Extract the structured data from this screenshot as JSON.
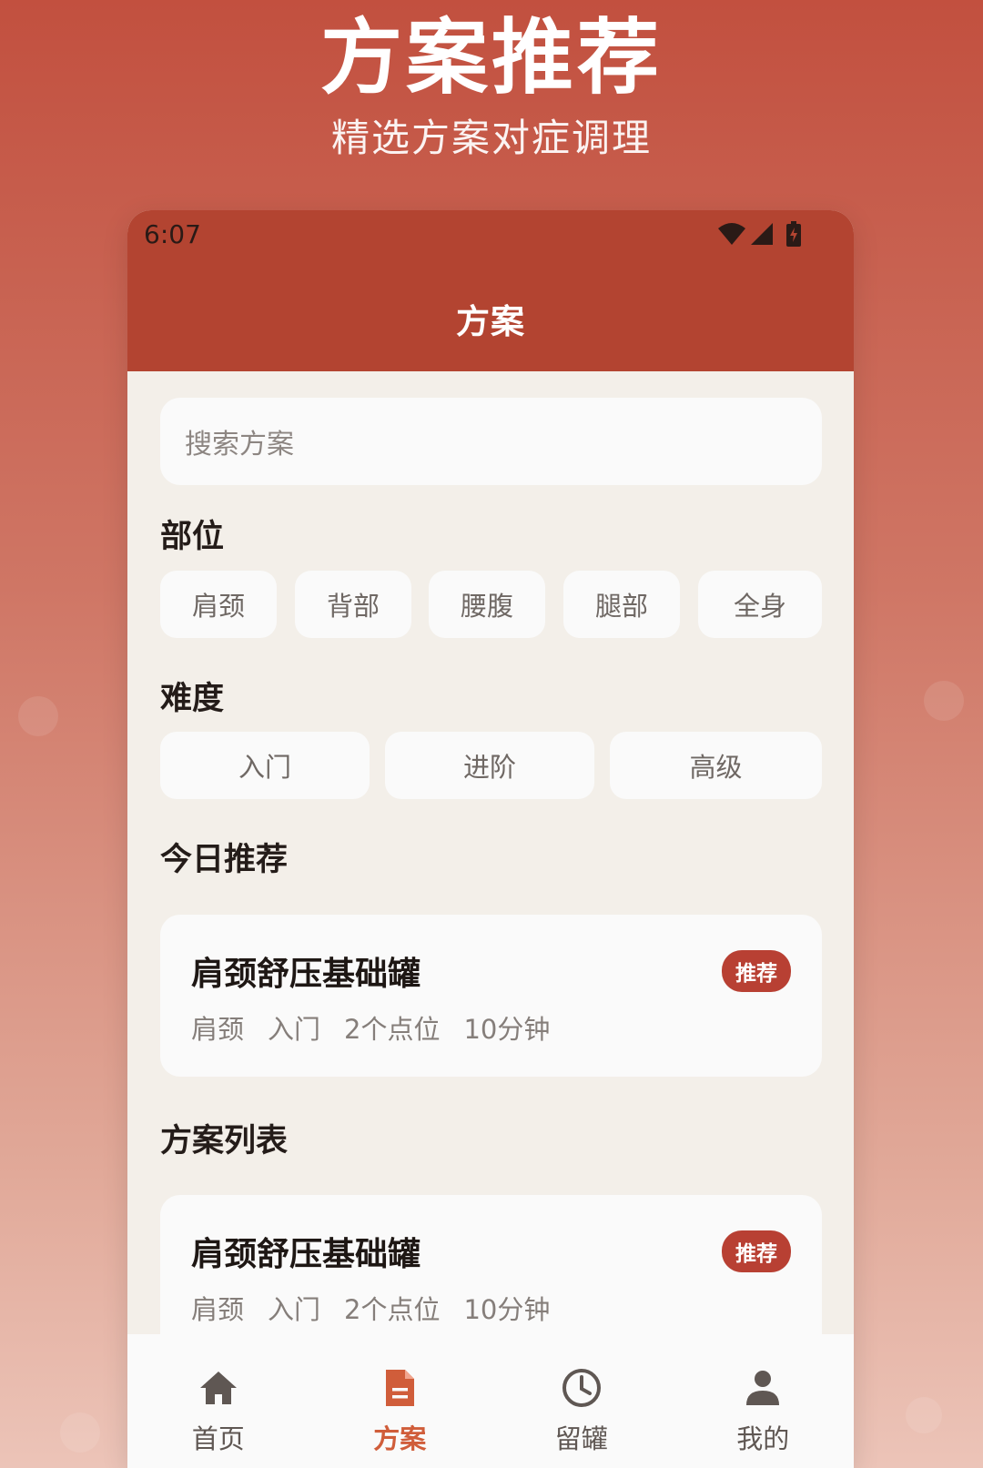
{
  "promo": {
    "title": "方案推荐",
    "subtitle": "精选方案对症调理"
  },
  "status_bar": {
    "time": "6:07",
    "icons": [
      "wifi-icon",
      "signal-icon",
      "battery-icon"
    ]
  },
  "app_bar": {
    "title": "方案"
  },
  "search": {
    "placeholder": "搜索方案"
  },
  "body_part": {
    "label": "部位",
    "options": [
      "肩颈",
      "背部",
      "腰腹",
      "腿部",
      "全身"
    ]
  },
  "difficulty": {
    "label": "难度",
    "options": [
      "入门",
      "进阶",
      "高级"
    ]
  },
  "today": {
    "label": "今日推荐",
    "card": {
      "title": "肩颈舒压基础罐",
      "badge": "推荐",
      "area": "肩颈",
      "level": "入门",
      "points": "2个点位",
      "duration": "10分钟"
    }
  },
  "plan_list": {
    "label": "方案列表",
    "items": [
      {
        "title": "肩颈舒压基础罐",
        "badge": "推荐",
        "area": "肩颈",
        "level": "入门",
        "points": "2个点位",
        "duration": "10分钟"
      }
    ]
  },
  "bottom_nav": {
    "items": [
      {
        "label": "首页",
        "icon": "home-icon",
        "active": false
      },
      {
        "label": "方案",
        "icon": "document-icon",
        "active": true
      },
      {
        "label": "留罐",
        "icon": "clock-icon",
        "active": false
      },
      {
        "label": "我的",
        "icon": "user-icon",
        "active": false
      }
    ]
  },
  "colors": {
    "primary": "#b34431",
    "badge": "#b84033",
    "nav_active": "#d05d3a",
    "page_bg": "#f3efe9",
    "card_bg": "#fafafa"
  }
}
